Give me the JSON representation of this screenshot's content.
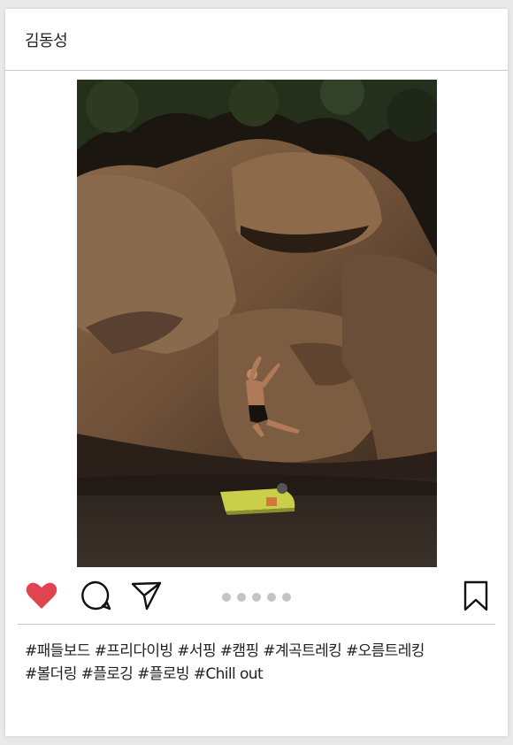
{
  "post": {
    "username": "김동성",
    "photo": {
      "subject": "rock-climber-bouldering",
      "colors": {
        "rock": "#7a5a3e",
        "shadow": "#1e1812",
        "foliage": "#2f3a22",
        "pad": "#c9cf48"
      }
    },
    "actions": {
      "like_icon": "heart-icon",
      "comment_icon": "comment-icon",
      "share_icon": "send-icon",
      "save_icon": "bookmark-icon",
      "liked": true,
      "like_color": "#e0444f"
    },
    "carousel": {
      "count": 5,
      "active": 0
    },
    "caption_lines": [
      "#패들보드 #프리다이빙 #서핑 #캠핑 #계곡트레킹 #오름트레킹",
      "#볼더링 #플로깅 #플로빙 #Chill out"
    ]
  }
}
